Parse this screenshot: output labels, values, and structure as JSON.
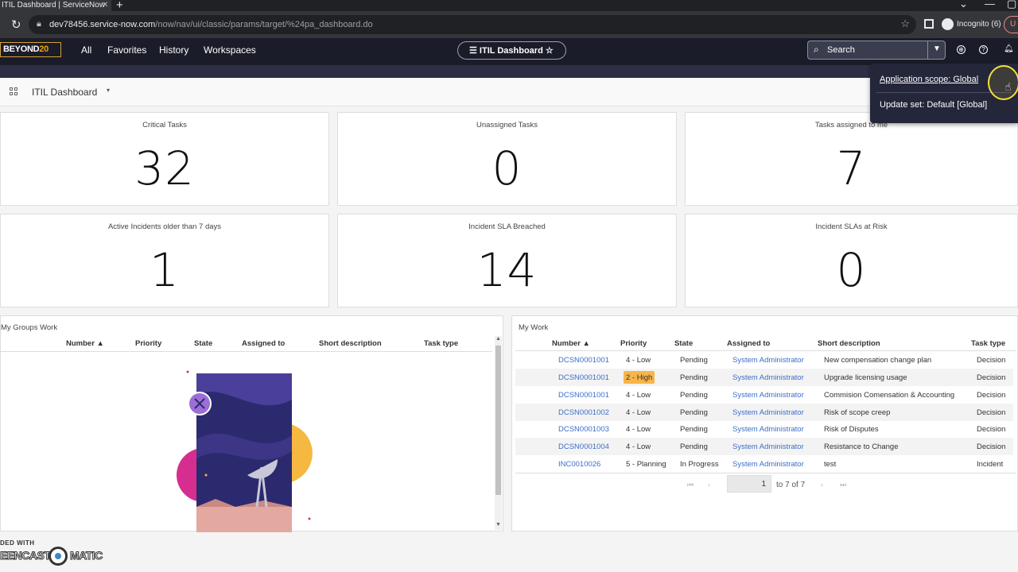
{
  "browser": {
    "tab_title": "ITIL Dashboard | ServiceNow",
    "new_tab": "+",
    "url_host": "dev78456.service-now.com",
    "url_path": "/now/nav/ui/classic/params/target/%24pa_dashboard.do",
    "incognito_label": "Incognito (6)",
    "update_label": "U"
  },
  "header": {
    "logo_text": "BEYOND",
    "logo_num": "20",
    "nav": [
      "All",
      "Favorites",
      "History",
      "Workspaces"
    ],
    "dashboard_pill": "ITIL Dashboard",
    "search_placeholder": "Search"
  },
  "dashboard": {
    "title": "ITIL Dashboard"
  },
  "scorecards": [
    {
      "title": "Critical Tasks",
      "value": "32"
    },
    {
      "title": "Unassigned Tasks",
      "value": "0"
    },
    {
      "title": "Tasks assigned to me",
      "value": "7"
    },
    {
      "title": "Active Incidents older than 7 days",
      "value": "1"
    },
    {
      "title": "Incident SLA Breached",
      "value": "14"
    },
    {
      "title": "Incident SLAs at Risk",
      "value": "0"
    }
  ],
  "group_work": {
    "title": "My Groups Work",
    "columns": [
      "Number ▲",
      "Priority",
      "State",
      "Assigned to",
      "Short description",
      "Task type"
    ]
  },
  "my_work": {
    "title": "My Work",
    "columns": [
      "Number ▲",
      "Priority",
      "State",
      "Assigned to",
      "Short description",
      "Task type"
    ],
    "rows": [
      {
        "number": "DCSN0001001",
        "priority": "4 - Low",
        "state": "Pending",
        "assigned": "System Administrator",
        "desc": "New compensation change plan",
        "type": "Decision"
      },
      {
        "number": "DCSN0001001",
        "priority": "2 - High",
        "state": "Pending",
        "assigned": "System Administrator",
        "desc": "Upgrade licensing usage",
        "type": "Decision"
      },
      {
        "number": "DCSN0001001",
        "priority": "4 - Low",
        "state": "Pending",
        "assigned": "System Administrator",
        "desc": "Commision Comensation & Accounting",
        "type": "Decision"
      },
      {
        "number": "DCSN0001002",
        "priority": "4 - Low",
        "state": "Pending",
        "assigned": "System Administrator",
        "desc": "Risk of scope creep",
        "type": "Decision"
      },
      {
        "number": "DCSN0001003",
        "priority": "4 - Low",
        "state": "Pending",
        "assigned": "System Administrator",
        "desc": "Risk of Disputes",
        "type": "Decision"
      },
      {
        "number": "DCSN0001004",
        "priority": "4 - Low",
        "state": "Pending",
        "assigned": "System Administrator",
        "desc": "Resistance to Change",
        "type": "Decision"
      },
      {
        "number": "INC0010026",
        "priority": "5 - Planning",
        "state": "In Progress",
        "assigned": "System Administrator",
        "desc": "test",
        "type": "Incident"
      }
    ],
    "pager_value": "1",
    "pager_text": "to 7 of 7"
  },
  "popover": {
    "scope": "Application scope: Global",
    "update_set": "Update set: Default [Global]"
  },
  "watermark": {
    "top": "DED WITH",
    "left": "EENCAST",
    "right": "MATIC"
  },
  "colors": {
    "header_bg": "#1b1c2a",
    "link": "#3d6ec9",
    "high_priority": "#f7b54a",
    "cursor_highlight": "#f3e23a"
  }
}
